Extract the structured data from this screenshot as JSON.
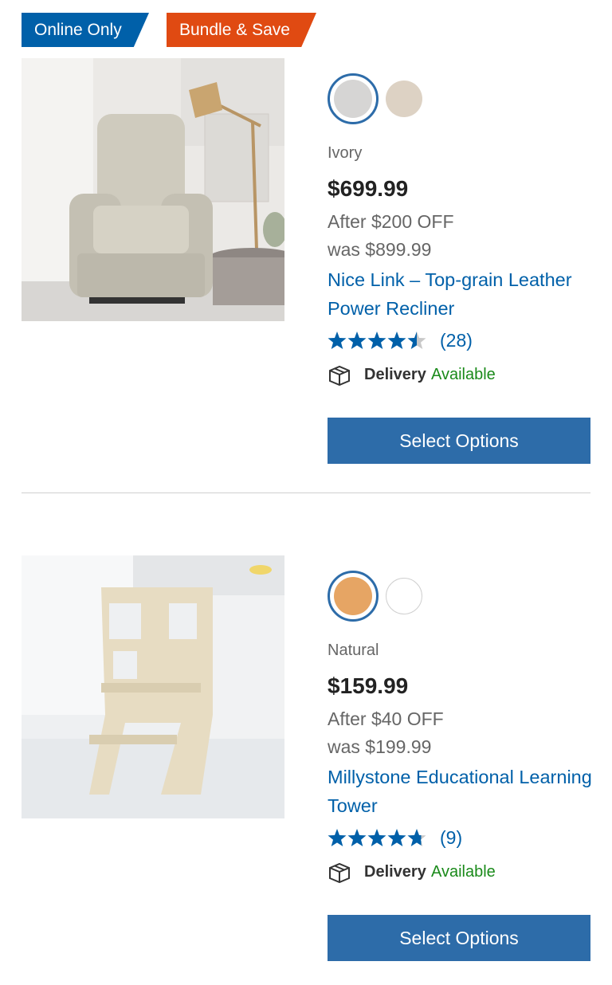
{
  "badges": {
    "online_only": "Online Only",
    "bundle_save": "Bundle & Save"
  },
  "colors": {
    "brand_blue": "#0060a9",
    "badge_orange": "#e04a12",
    "button_blue": "#2d6ca9",
    "available_green": "#1a8a1a"
  },
  "products": [
    {
      "image": "power recliner chair photo",
      "swatches": [
        {
          "name": "Ivory",
          "color": "#d6d5d4",
          "selected": true
        },
        {
          "name": "Beige",
          "color": "#ddd2c4",
          "selected": false
        }
      ],
      "color_name": "Ivory",
      "price": "$699.99",
      "after": "After $200 OFF",
      "was": "was $899.99",
      "title": "Nice Link – Top-grain Leather Power Recliner",
      "rating": 4.5,
      "review_count": "(28)",
      "delivery_label": "Delivery",
      "delivery_status": "Available",
      "cta": "Select Options"
    },
    {
      "image": "wooden learning tower photo",
      "swatches": [
        {
          "name": "Natural",
          "color": "#e6a564",
          "selected": true
        },
        {
          "name": "White",
          "color": "#ffffff",
          "selected": false
        }
      ],
      "color_name": "Natural",
      "price": "$159.99",
      "after": "After $40 OFF",
      "was": "was $199.99",
      "title": "Millystone Educational Learning Tower",
      "rating": 4.7,
      "review_count": "(9)",
      "delivery_label": "Delivery",
      "delivery_status": "Available",
      "cta": "Select Options"
    }
  ]
}
